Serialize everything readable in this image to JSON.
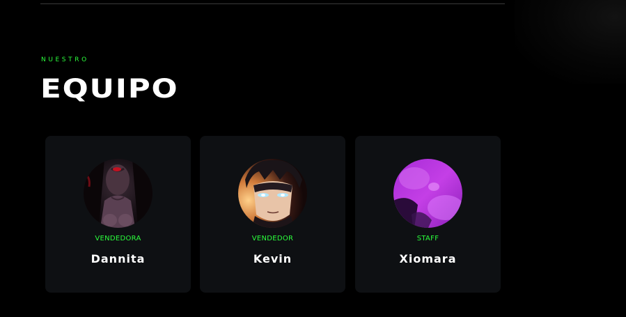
{
  "section": {
    "eyebrow": "NUESTRO",
    "title": "EQUIPO"
  },
  "team": [
    {
      "role": "VENDEDORA",
      "name": "Dannita",
      "avatar": "dark-portrait-avatar"
    },
    {
      "role": "VENDEDOR",
      "name": "Kevin",
      "avatar": "anime-glowing-eyes-avatar"
    },
    {
      "role": "STAFF",
      "name": "Xiomara",
      "avatar": "purple-abstract-avatar"
    }
  ],
  "colors": {
    "background": "#000000",
    "card": "#0e1013",
    "accent_green": "#2bff3c",
    "text_white": "#ffffff"
  }
}
